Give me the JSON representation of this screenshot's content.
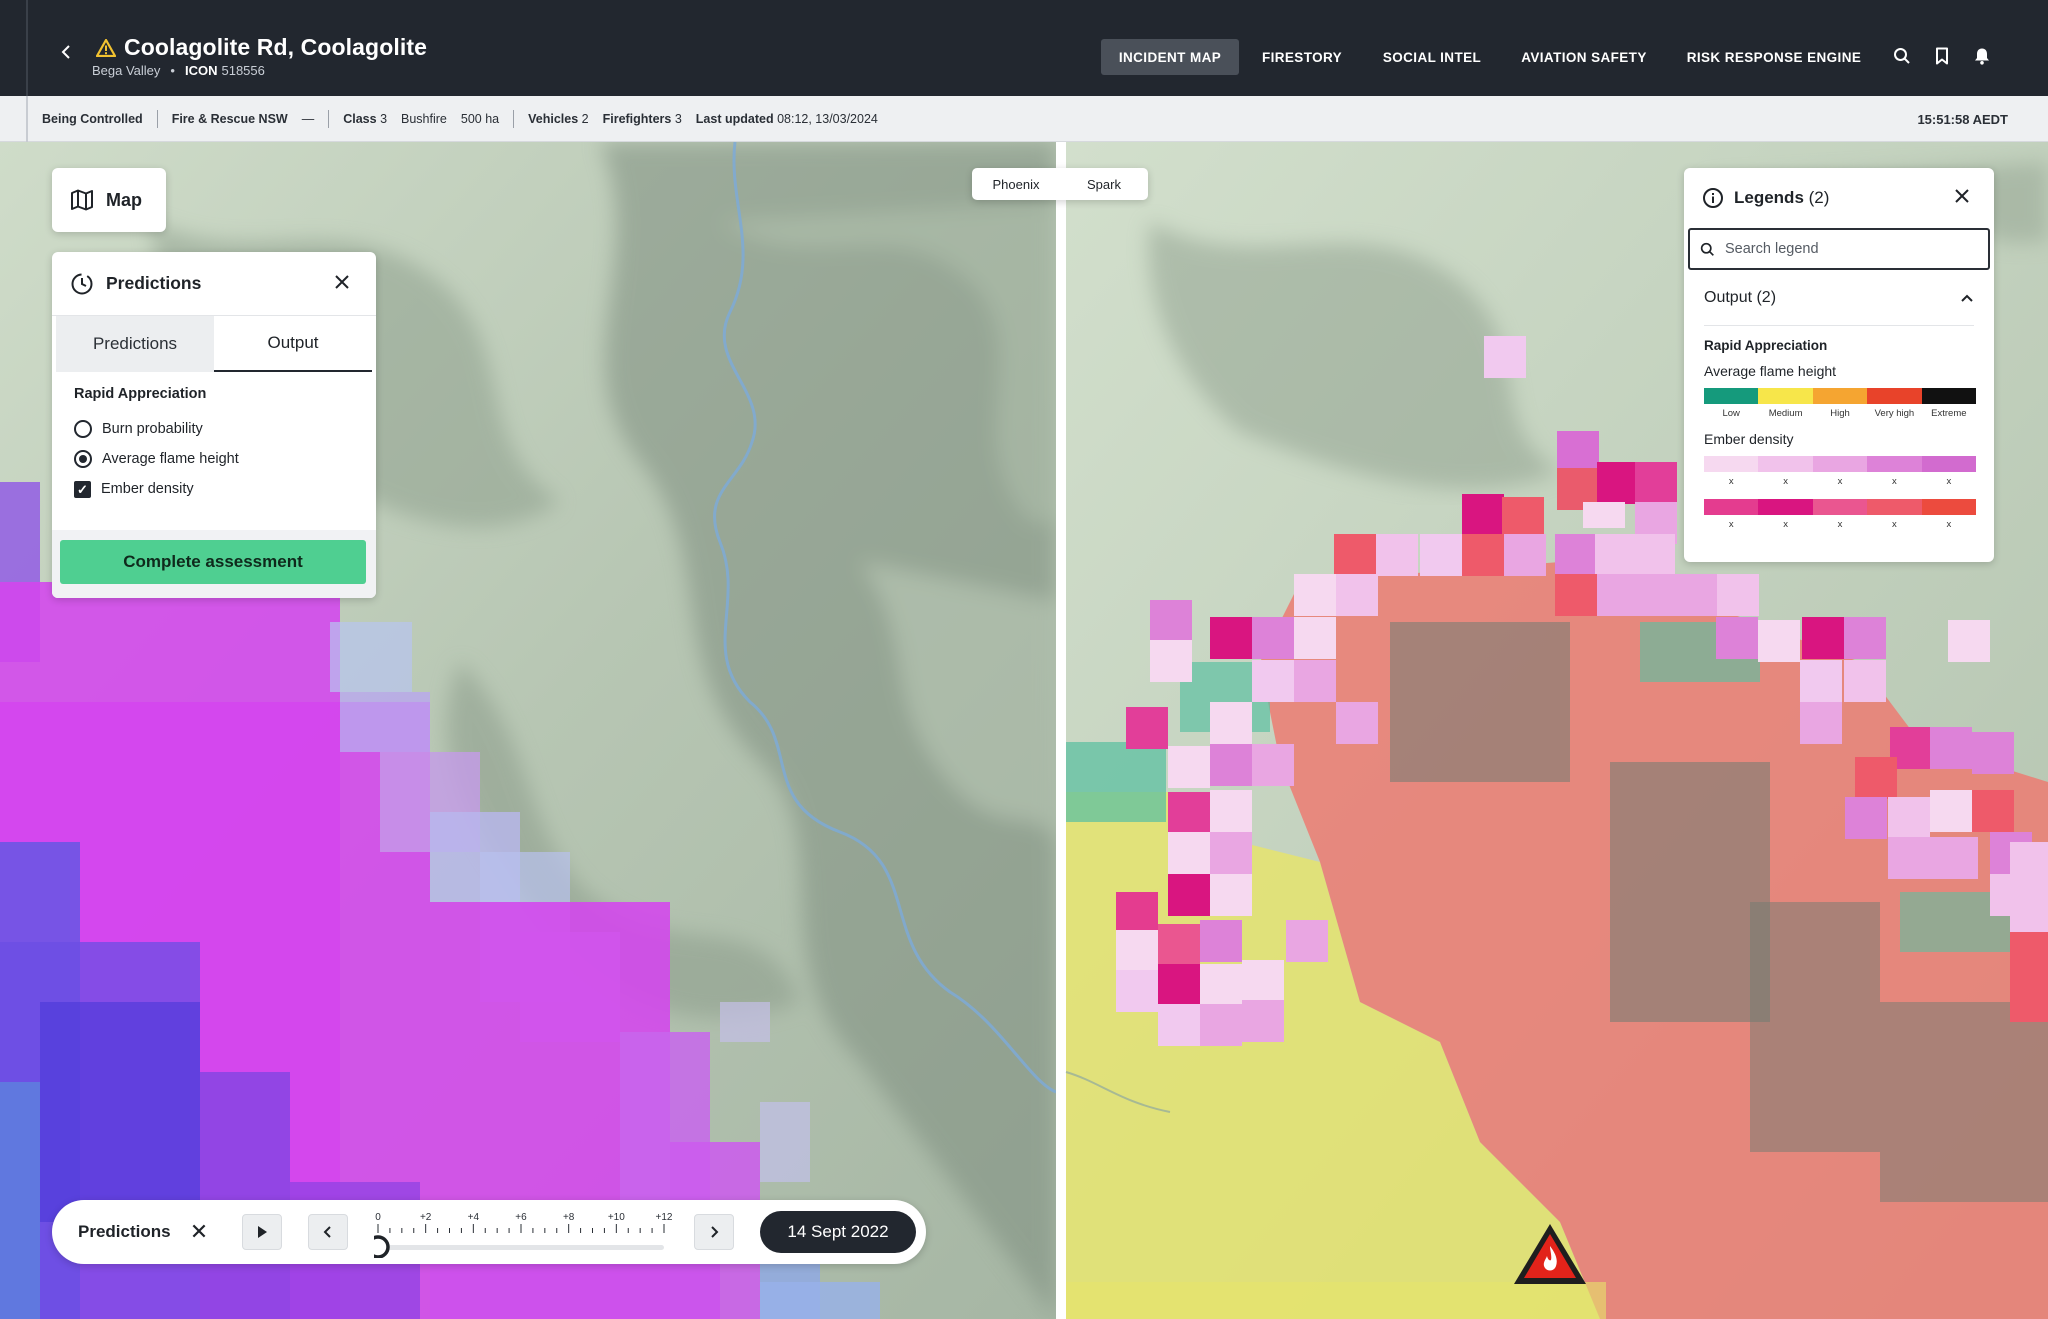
{
  "header": {
    "title": "Coolagolite Rd, Coolagolite",
    "region": "Bega Valley",
    "icon_label": "ICON",
    "icon_number": "518556",
    "nav": [
      {
        "label": "INCIDENT MAP",
        "active": true
      },
      {
        "label": "FIRESTORY",
        "active": false
      },
      {
        "label": "SOCIAL INTEL",
        "active": false
      },
      {
        "label": "AVIATION SAFETY",
        "active": false
      },
      {
        "label": "RISK RESPONSE ENGINE",
        "active": false
      }
    ],
    "icons": [
      "search-icon",
      "bookmark-icon",
      "bell-icon"
    ],
    "warning_color": "#f2c230"
  },
  "status": {
    "state": "Being Controlled",
    "agency": "Fire & Rescue NSW",
    "dash": "—",
    "class_label": "Class",
    "class_value": "3",
    "type": "Bushfire",
    "area": "500 ha",
    "vehicles_label": "Vehicles",
    "vehicles_value": "2",
    "firefighters_label": "Firefighters",
    "firefighters_value": "3",
    "updated_label": "Last updated",
    "updated_value": "08:12, 13/03/2024",
    "clock": "15:51:58 AEDT"
  },
  "map_button": {
    "label": "Map",
    "icon": "map-icon"
  },
  "predictions_panel": {
    "title": "Predictions",
    "tabs": [
      {
        "label": "Predictions",
        "active": false
      },
      {
        "label": "Output",
        "active": true
      }
    ],
    "group_title": "Rapid Appreciation",
    "options": [
      {
        "label": "Burn probability",
        "type": "radio",
        "checked": false
      },
      {
        "label": "Average flame height",
        "type": "radio",
        "checked": true
      },
      {
        "label": "Ember density",
        "type": "checkbox",
        "checked": true
      }
    ],
    "button": "Complete assessment",
    "button_color": "#4fcf91"
  },
  "split_toggle": {
    "left": "Phoenix",
    "right": "Spark"
  },
  "legend": {
    "title": "Legends",
    "count": "(2)",
    "search_placeholder": "Search legend",
    "section": "Output (2)",
    "group_title": "Rapid Appreciation",
    "flame": {
      "label": "Average flame height",
      "colors": [
        "#159a7c",
        "#f7e64a",
        "#f5a531",
        "#e8432a",
        "#111111"
      ],
      "labels": [
        "Low",
        "Medium",
        "High",
        "Very high",
        "Extreme"
      ]
    },
    "ember": {
      "label": "Ember density",
      "row1_colors": [
        "#f6d9f0",
        "#f1c2eb",
        "#e9a6e2",
        "#dd82d8",
        "#d26bcf"
      ],
      "row2_colors": [
        "#e43c8f",
        "#d91580",
        "#ea5690",
        "#ee5a6a",
        "#ec4b3e"
      ],
      "labels": [
        "x",
        "x",
        "x",
        "x",
        "x"
      ]
    }
  },
  "timeline": {
    "title": "Predictions",
    "ticks": [
      "0",
      "+2",
      "+4",
      "+6",
      "+8",
      "+10",
      "+12"
    ],
    "position": 0,
    "date": "14 Sept 2022"
  }
}
